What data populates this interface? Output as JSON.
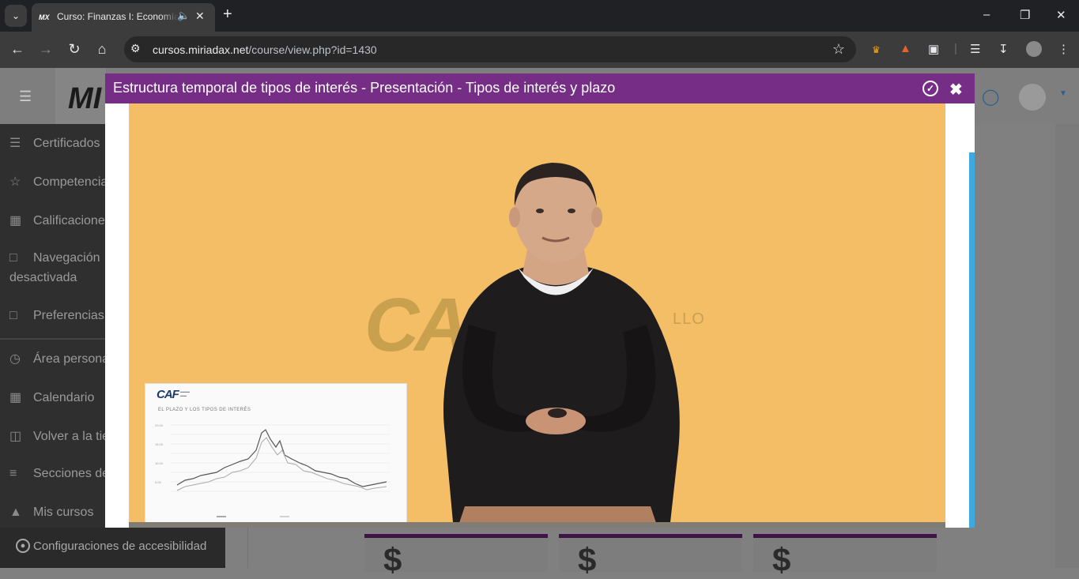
{
  "browser": {
    "tab": {
      "favicon": "MX",
      "title": "Curso: Finanzas I: Economía",
      "audio_icon": "speaker-icon",
      "close_icon": "close-icon"
    },
    "new_tab_icon": "plus-icon",
    "window_controls": [
      "minimize-icon",
      "restore-icon",
      "close-icon"
    ],
    "address": {
      "host": "cursos.miriadax.net",
      "path": "/course/view.php?id=1430"
    },
    "nav_icons": [
      "back-icon",
      "forward-icon",
      "reload-icon",
      "home-icon"
    ],
    "extension_icons": [
      "crown-icon",
      "graduation-cap-icon",
      "puzzle-icon",
      "media-control-icon",
      "download-icon",
      "profile-icon",
      "kebab-menu-icon"
    ]
  },
  "page": {
    "brand": "MI",
    "sidebar": {
      "items": [
        {
          "label": "Certificados",
          "icon": "layers-icon"
        },
        {
          "label": "Competencias",
          "icon": "star-icon"
        },
        {
          "label": "Calificaciones",
          "icon": "book-icon"
        },
        {
          "label": "Navegación",
          "label2": "desactivada",
          "icon": "folder-icon"
        },
        {
          "label": "Preferencias",
          "icon": "folder-icon"
        },
        {
          "label": "Área personal",
          "icon": "dashboard-icon"
        },
        {
          "label": "Calendario",
          "icon": "calendar-icon"
        },
        {
          "label": "Volver a la tienda",
          "icon": "cart-icon"
        },
        {
          "label": "Secciones del curso",
          "icon": "list-icon"
        },
        {
          "label": "Mis cursos",
          "icon": "graduation-cap-icon"
        }
      ]
    },
    "accessibility": {
      "label": "Configuraciones de accesibilidad",
      "icon": "accessibility-icon"
    },
    "cards": [
      {
        "symbol": "$"
      },
      {
        "symbol": "$"
      },
      {
        "symbol": "$"
      }
    ],
    "colors": {
      "accent": "#762d86",
      "scrollbar": "#3ea8e0"
    }
  },
  "modal": {
    "title": "Estructura temporal de tipos de interés - Presentación - Tipos de interés y plazo",
    "check_icon": "check-circle-icon",
    "close_icon": "close-icon",
    "video": {
      "background_logo": "CAF",
      "background_logo_sub": "LLO",
      "slide": {
        "logo": "CAF",
        "title": "EL PLAZO Y LOS TIPOS DE INTERÉS"
      }
    }
  }
}
